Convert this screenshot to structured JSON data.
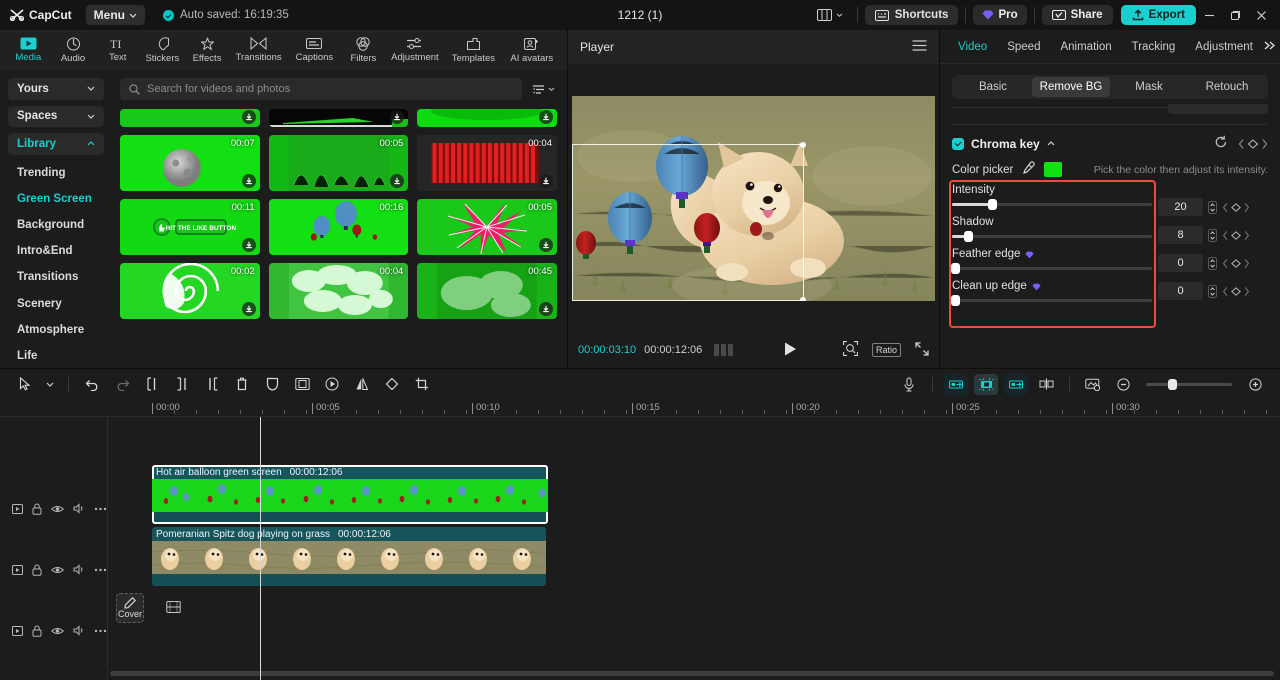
{
  "titlebar": {
    "app_name": "CapCut",
    "menu_label": "Menu",
    "autosave_text": "Auto saved: 16:19:35",
    "project_title": "1212 (1)",
    "shortcuts_label": "Shortcuts",
    "pro_label": "Pro",
    "share_label": "Share",
    "export_label": "Export",
    "accent_color": "#1ccfcf"
  },
  "nav_tabs": [
    {
      "label": "Media",
      "icon": "media-icon",
      "active": true
    },
    {
      "label": "Audio",
      "icon": "audio-icon",
      "active": false
    },
    {
      "label": "Text",
      "icon": "text-icon",
      "active": false
    },
    {
      "label": "Stickers",
      "icon": "stickers-icon",
      "active": false
    },
    {
      "label": "Effects",
      "icon": "effects-icon",
      "active": false
    },
    {
      "label": "Transitions",
      "icon": "transitions-icon",
      "active": false
    },
    {
      "label": "Captions",
      "icon": "captions-icon",
      "active": false
    },
    {
      "label": "Filters",
      "icon": "filters-icon",
      "active": false
    },
    {
      "label": "Adjustment",
      "icon": "adjustment-icon",
      "active": false
    },
    {
      "label": "Templates",
      "icon": "templates-icon",
      "active": false
    },
    {
      "label": "AI avatars",
      "icon": "ai-avatars-icon",
      "active": false
    }
  ],
  "sidebar": {
    "dropdowns": [
      {
        "label": "Yours",
        "expanded": false
      },
      {
        "label": "Spaces",
        "expanded": false
      },
      {
        "label": "Library",
        "expanded": true
      }
    ],
    "items": [
      {
        "label": "Trending",
        "active": false
      },
      {
        "label": "Green Screen",
        "active": true
      },
      {
        "label": "Background",
        "active": false
      },
      {
        "label": "Intro&End",
        "active": false
      },
      {
        "label": "Transitions",
        "active": false
      },
      {
        "label": "Scenery",
        "active": false
      },
      {
        "label": "Atmosphere",
        "active": false
      },
      {
        "label": "Life",
        "active": false
      }
    ]
  },
  "search": {
    "placeholder": "Search for videos and photos",
    "value": "",
    "filter_icon": "filter-icon"
  },
  "media_grid": [
    {
      "duration": "",
      "kind": "green-strip",
      "row": 0
    },
    {
      "duration": "",
      "kind": "black-green",
      "row": 0
    },
    {
      "duration": "",
      "kind": "green-strip2",
      "row": 0
    },
    {
      "duration": "00:07",
      "kind": "moon",
      "row": 1
    },
    {
      "duration": "00:05",
      "kind": "green-texture",
      "row": 1
    },
    {
      "duration": "00:04",
      "kind": "red-curtain",
      "row": 1
    },
    {
      "duration": "00:11",
      "kind": "like-button",
      "row": 2
    },
    {
      "duration": "00:16",
      "kind": "balloons",
      "row": 2
    },
    {
      "duration": "00:05",
      "kind": "pink-burst",
      "row": 2
    },
    {
      "duration": "00:02",
      "kind": "swirl",
      "row": 3
    },
    {
      "duration": "00:04",
      "kind": "clouds",
      "row": 3
    },
    {
      "duration": "00:45",
      "kind": "smoke",
      "row": 3
    }
  ],
  "player": {
    "title": "Player",
    "menu_icon": "hamburger-icon",
    "current_time": "00:00:03:10",
    "total_time": "00:00:12:06",
    "play_icon": "play-icon",
    "ratio_label": "Ratio",
    "zoom_icon": "zoom-fit-icon",
    "fullscreen_icon": "fullscreen-icon"
  },
  "properties": {
    "tabs": [
      {
        "label": "Video",
        "active": true
      },
      {
        "label": "Speed",
        "active": false
      },
      {
        "label": "Animation",
        "active": false
      },
      {
        "label": "Tracking",
        "active": false
      },
      {
        "label": "Adjustment",
        "active": false
      }
    ],
    "subtabs": [
      {
        "label": "Basic",
        "active": false
      },
      {
        "label": "Remove BG",
        "active": true
      },
      {
        "label": "Mask",
        "active": false
      },
      {
        "label": "Retouch",
        "active": false
      }
    ],
    "chroma_key": {
      "title": "Chroma key",
      "enabled": true,
      "reset_icon": "reset-icon",
      "keyframe_icon": "keyframe-icon",
      "color_picker_label": "Color picker",
      "eyedropper_icon": "eyedropper-icon",
      "picked_color": "#11e011",
      "hint": "Pick the color then adjust its intensity.",
      "highlight_color": "#ef4a3c",
      "sliders": [
        {
          "label": "Intensity",
          "value": "20",
          "percent": 20,
          "pro": false
        },
        {
          "label": "Shadow",
          "value": "8",
          "percent": 8,
          "pro": false
        },
        {
          "label": "Feather edge",
          "value": "0",
          "percent": 0,
          "pro": true
        },
        {
          "label": "Clean up edge",
          "value": "0",
          "percent": 0,
          "pro": true
        }
      ]
    }
  },
  "timeline": {
    "tools": [
      {
        "name": "select-tool-icon"
      },
      {
        "name": "chevron-down-icon"
      },
      {
        "name": "undo-icon"
      },
      {
        "name": "redo-icon"
      },
      {
        "name": "split-icon"
      },
      {
        "name": "trim-left-icon"
      },
      {
        "name": "trim-right-icon"
      },
      {
        "name": "delete-icon"
      },
      {
        "name": "freeze-icon"
      },
      {
        "name": "crop-frame-icon"
      },
      {
        "name": "speed-icon"
      },
      {
        "name": "mirror-icon"
      },
      {
        "name": "rotate-icon"
      },
      {
        "name": "crop-icon"
      }
    ],
    "right_tools": [
      {
        "name": "mic-icon",
        "active": false
      },
      {
        "name": "link-clip-icon",
        "active": true
      },
      {
        "name": "auto-snap-icon",
        "active": true
      },
      {
        "name": "adsorb-icon",
        "active": true
      },
      {
        "name": "center-icon",
        "active": false
      },
      {
        "name": "preview-icon",
        "active": false
      },
      {
        "name": "zoom-out-icon",
        "active": false
      },
      {
        "name": "zoom-in-icon",
        "active": false
      }
    ],
    "ruler_labels": [
      "00:00",
      "00:05",
      "00:10",
      "00:15",
      "00:20",
      "00:25",
      "00:30"
    ],
    "track_controls": [
      "play-track-icon",
      "lock-icon",
      "eye-icon",
      "volume-icon",
      "more-icon"
    ],
    "clips": [
      {
        "name": "Hot air balloon green screen",
        "duration": "00:00:12:06",
        "selected": true,
        "kind": "green"
      },
      {
        "name": "Pomeranian Spitz dog playing on grass",
        "duration": "00:00:12:06",
        "selected": false,
        "kind": "dog"
      }
    ],
    "cover_label": "Cover",
    "cover_icon": "pencil-icon",
    "add_track_icon": "film-icon"
  }
}
